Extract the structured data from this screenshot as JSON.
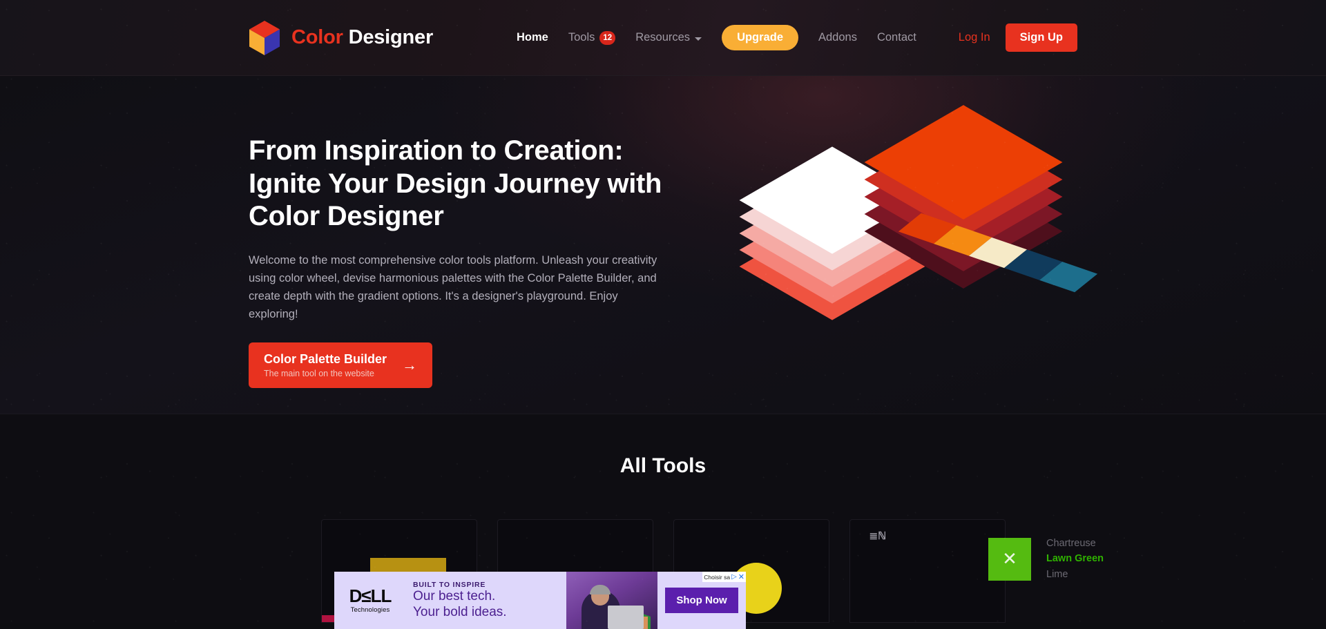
{
  "brand": {
    "name_part1": "Color",
    "name_part2": " Designer",
    "logo_icon": "cube-logo-icon",
    "logo_colors": {
      "top": "#e8321f",
      "left": "#f9ae35",
      "right": "#3a35b0"
    }
  },
  "nav": {
    "items": [
      {
        "label": "Home",
        "active": true,
        "badge": null,
        "has_caret": false
      },
      {
        "label": "Tools",
        "active": false,
        "badge": "12",
        "has_caret": false
      },
      {
        "label": "Resources",
        "active": false,
        "badge": null,
        "has_caret": true
      },
      {
        "label": "Addons",
        "active": false,
        "badge": null,
        "has_caret": false
      },
      {
        "label": "Contact",
        "active": false,
        "badge": null,
        "has_caret": false
      }
    ],
    "upgrade_label": "Upgrade",
    "login_label": "Log In",
    "signup_label": "Sign Up",
    "accent_upgrade": "#f9ae35",
    "accent_signup": "#e8321f",
    "badge_color": "#d8261b"
  },
  "hero": {
    "title_line1": "From Inspiration to Creation:",
    "title_line2": "Ignite Your Design Journey with",
    "title_line3": "Color Designer",
    "paragraph": "Welcome to the most comprehensive color tools platform. Unleash your creativity using color wheel, devise harmonious palettes with the Color Palette Builder, and create depth with the gradient options. It's a designer's playground. Enjoy exploring!",
    "cta_main": "Color Palette Builder",
    "cta_sub": "The main tool on the website",
    "cta_arrow": "→",
    "cta_color": "#e8321f",
    "illustration": {
      "left_stack_colors": [
        "#ffffff",
        "#f6d5d4",
        "#f5aaa4",
        "#f5847a",
        "#ef5340"
      ],
      "right_stack_colors": [
        "#ec3f05",
        "#cf2f20",
        "#a51f27",
        "#7c1726",
        "#4e0f1c"
      ],
      "ribbon_colors": [
        "#e23c06",
        "#f58a12",
        "#f6eac7",
        "#103b5c",
        "#1d6e8c"
      ]
    }
  },
  "tools": {
    "section_title": "All Tools",
    "cards": [
      {
        "name": "card-1",
        "big_swatch": "#b79112",
        "strip": [
          "#b01340",
          "#b79112",
          "#7ba4b0",
          "#10657f",
          "#0e4c60"
        ]
      },
      {
        "name": "card-2",
        "big_swatch": "#0e0d12",
        "strip": []
      },
      {
        "name": "card-3",
        "big_swatch": "#e8d21a",
        "strip": []
      },
      {
        "name": "card-4",
        "big_swatch": "#0e0d12",
        "strip": [],
        "mark": "≣ℕ"
      }
    ]
  },
  "color_list": {
    "swatch_color": "#55bb11",
    "close_icon": "✕",
    "names": [
      {
        "label": "Chartreuse",
        "state": "dim"
      },
      {
        "label": "Lawn Green",
        "state": "active"
      },
      {
        "label": "Lime",
        "state": "dim"
      }
    ]
  },
  "ad": {
    "brand": "D≤LL",
    "brand_sub": "Technologies",
    "kicker": "BUILT TO INSPIRE",
    "line1": "Our best tech.",
    "line2": "Your bold ideas.",
    "cta": "Shop Now",
    "choices_label": "Choisir sa",
    "choices_triangle": "▷",
    "close_icon": "✕",
    "bg_color": "#ded7fb",
    "cta_color": "#5b1fad"
  }
}
